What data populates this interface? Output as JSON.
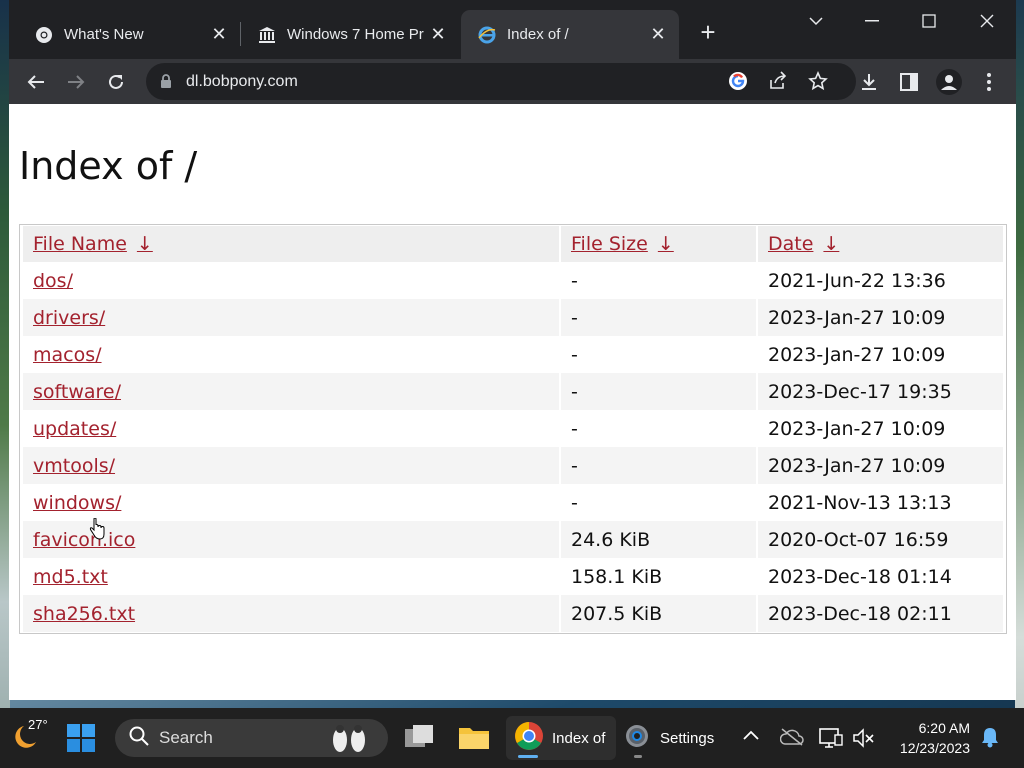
{
  "tabs": [
    {
      "title": "What's New",
      "icon": "chrome-icon"
    },
    {
      "title": "Windows 7 Home Pr",
      "icon": "museum-icon"
    },
    {
      "title": "Index of /",
      "icon": "ie-icon",
      "active": true
    }
  ],
  "toolbar": {
    "url": "dl.bobpony.com"
  },
  "page": {
    "title": "Index of /",
    "columns": [
      {
        "label": "File Name",
        "arrow": "↓"
      },
      {
        "label": "File Size",
        "arrow": "↓"
      },
      {
        "label": "Date",
        "arrow": "↓"
      }
    ],
    "rows": [
      {
        "name": "dos/",
        "size": "-",
        "date": "2021-Jun-22 13:36"
      },
      {
        "name": "drivers/",
        "size": "-",
        "date": "2023-Jan-27 10:09"
      },
      {
        "name": "macos/",
        "size": "-",
        "date": "2023-Jan-27 10:09"
      },
      {
        "name": "software/",
        "size": "-",
        "date": "2023-Dec-17 19:35"
      },
      {
        "name": "updates/",
        "size": "-",
        "date": "2023-Jan-27 10:09"
      },
      {
        "name": "vmtools/",
        "size": "-",
        "date": "2023-Jan-27 10:09"
      },
      {
        "name": "windows/",
        "size": "-",
        "date": "2021-Nov-13 13:13"
      },
      {
        "name": "favicon.ico",
        "size": "24.6 KiB",
        "date": "2020-Oct-07 16:59"
      },
      {
        "name": "md5.txt",
        "size": "158.1 KiB",
        "date": "2023-Dec-18 01:14"
      },
      {
        "name": "sha256.txt",
        "size": "207.5 KiB",
        "date": "2023-Dec-18 02:11"
      }
    ]
  },
  "taskbar": {
    "weather_temp": "27°",
    "search_label": "Search",
    "apps": [
      {
        "label": "Index of",
        "icon": "chrome-icon"
      },
      {
        "label": "Settings",
        "icon": "settings-gear-icon"
      }
    ],
    "time": "6:20 AM",
    "date": "12/23/2023"
  },
  "colors": {
    "link": "#a3222e",
    "tabstrip": "#202124",
    "toolbar": "#35363a",
    "taskbar": "#202020"
  }
}
